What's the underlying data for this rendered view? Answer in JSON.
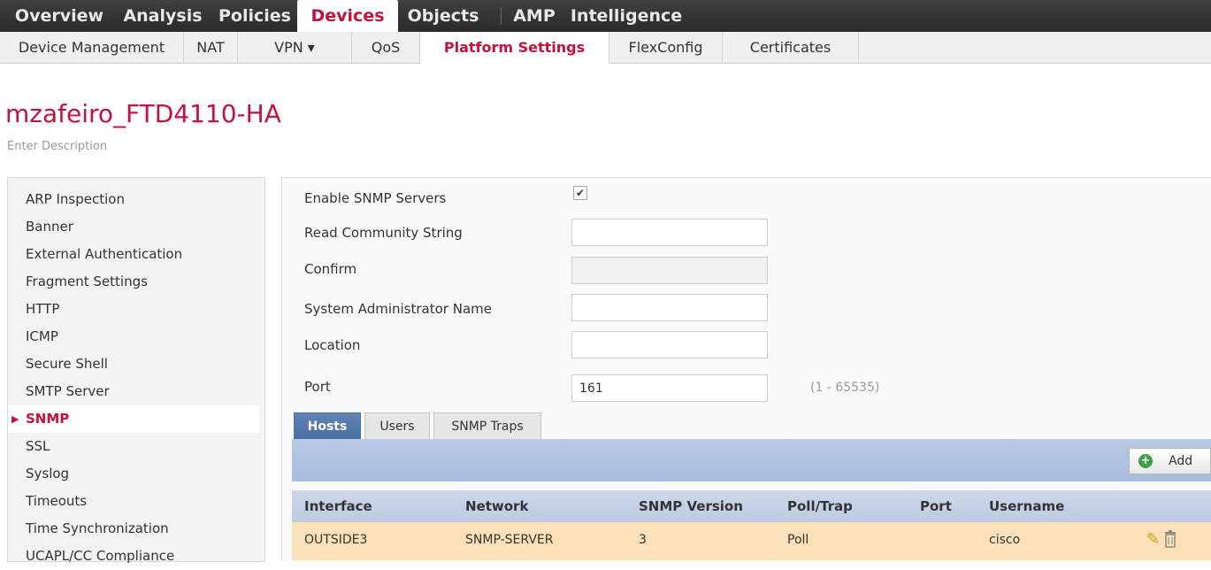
{
  "topnav": {
    "items": [
      "Overview",
      "Analysis",
      "Policies",
      "Devices",
      "Objects",
      "AMP",
      "Intelligence"
    ],
    "active": "Devices"
  },
  "subnav": {
    "items": [
      "Device Management",
      "NAT",
      "VPN ▾",
      "QoS",
      "Platform Settings",
      "FlexConfig",
      "Certificates"
    ],
    "active": "Platform Settings"
  },
  "page": {
    "title": "mzafeiro_FTD4110-HA",
    "description": "Enter Description"
  },
  "sidebar": {
    "items": [
      "ARP Inspection",
      "Banner",
      "External Authentication",
      "Fragment Settings",
      "HTTP",
      "ICMP",
      "Secure Shell",
      "SMTP Server",
      "SNMP",
      "SSL",
      "Syslog",
      "Timeouts",
      "Time Synchronization",
      "UCAPL/CC Compliance"
    ],
    "active": "SNMP"
  },
  "form": {
    "enable_label": "Enable SNMP Servers",
    "enable_checked": true,
    "enable_check_glyph": "✔",
    "read_community_label": "Read Community String",
    "read_community_value": "",
    "confirm_label": "Confirm",
    "confirm_value": "",
    "admin_name_label": "System Administrator Name",
    "admin_name_value": "",
    "location_label": "Location",
    "location_value": "",
    "port_label": "Port",
    "port_value": "161",
    "port_hint": "(1 - 65535)"
  },
  "tabs": {
    "items": [
      "Hosts",
      "Users",
      "SNMP Traps"
    ],
    "active": "Hosts"
  },
  "table": {
    "add_label": "Add",
    "headers": [
      "Interface",
      "Network",
      "SNMP Version",
      "Poll/Trap",
      "Port",
      "Username"
    ],
    "rows": [
      [
        "OUTSIDE3",
        "SNMP-SERVER",
        "3",
        "Poll",
        "",
        "cisco"
      ]
    ],
    "row_icons": [
      "pencil-icon",
      "trash-icon"
    ]
  },
  "colors": {
    "accent": "#c4123c",
    "tab_active": "#4a6fa1",
    "row_highlight": "#fbe0b8",
    "topnav_bg": "#333333"
  }
}
